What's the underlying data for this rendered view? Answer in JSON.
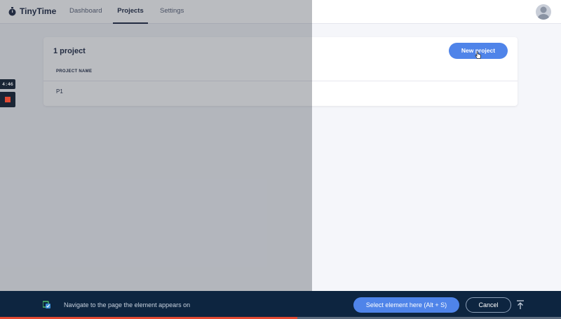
{
  "app": {
    "name": "TinyTime",
    "nav": [
      {
        "label": "Dashboard"
      },
      {
        "label": "Projects"
      },
      {
        "label": "Settings"
      }
    ],
    "active_tab": "Projects"
  },
  "projects": {
    "count_label": "1 project",
    "new_button": "New project",
    "column_header": "PROJECT NAME",
    "rows": [
      {
        "name": "P1"
      }
    ]
  },
  "recorder": {
    "timer": "4:46",
    "progress": 0.53
  },
  "bottom_bar": {
    "message": "Navigate to the page the element appears on",
    "select_button": "Select element here (Alt + S)",
    "cancel_button": "Cancel"
  },
  "colors": {
    "accent": "#4f84e9",
    "bar": "#0d2540",
    "record": "#e24a33"
  }
}
